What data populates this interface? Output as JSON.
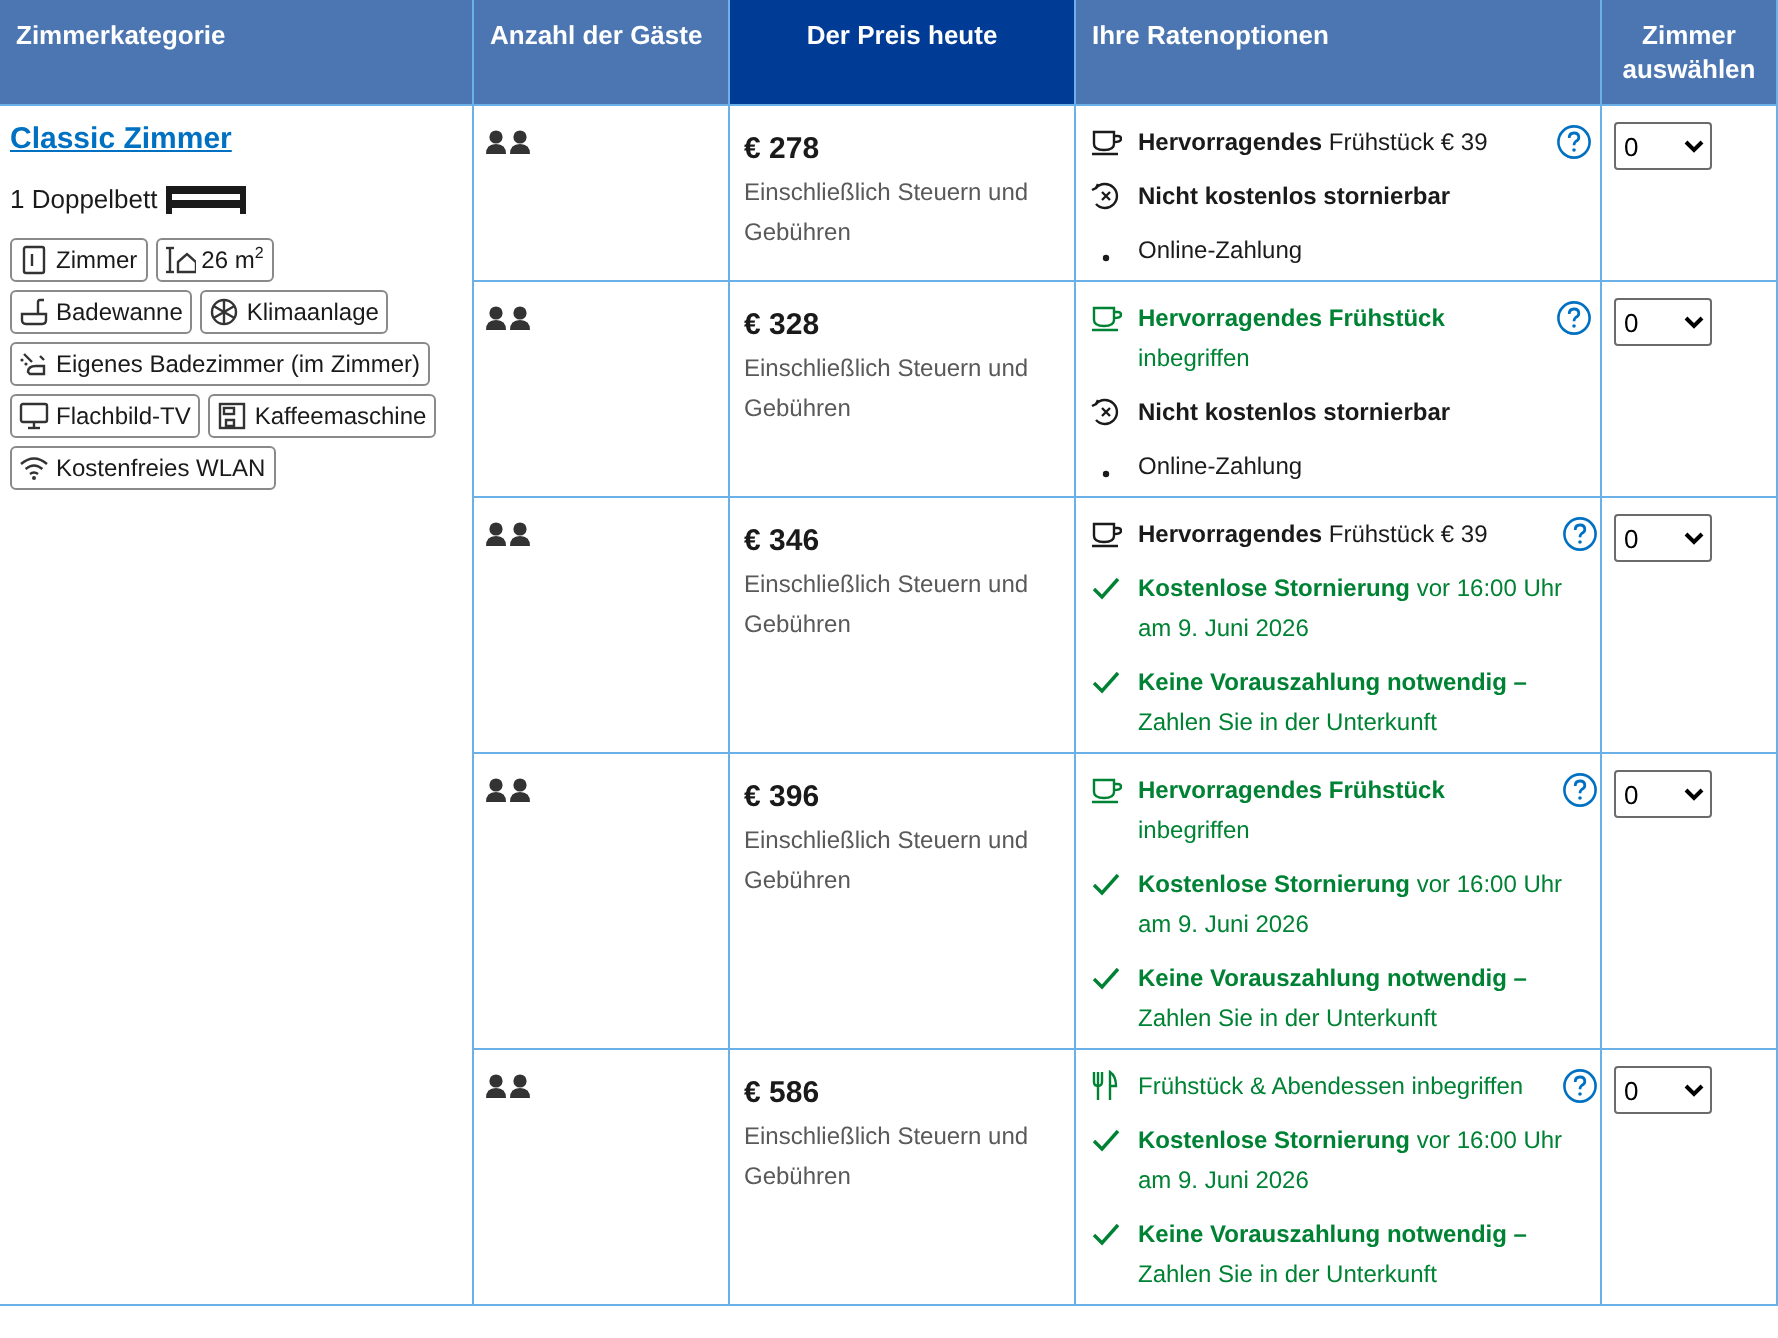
{
  "table": {
    "columns": [
      {
        "label": "Zimmerkategorie",
        "highlight": false
      },
      {
        "label": "Anzahl der Gäste",
        "highlight": false
      },
      {
        "label": "Der Preis heute",
        "highlight": true
      },
      {
        "label": "Ihre Ratenoptionen",
        "highlight": false
      },
      {
        "label": "Zimmer auswählen",
        "highlight": false
      }
    ],
    "room": {
      "name": "Classic Zimmer",
      "bed": "1 Doppelbett",
      "facilities": [
        {
          "kind": "door",
          "label": "Zimmer"
        },
        {
          "kind": "size",
          "label": "26 m$^{2}$"
        },
        {
          "kind": "bath",
          "label": "Badewanne"
        },
        {
          "kind": "snow",
          "label": "Klimaanlage"
        },
        {
          "kind": "shower",
          "label": "Eigenes Badezimmer (im Zimmer)"
        },
        {
          "kind": "tv",
          "label": "Flachbild-TV"
        },
        {
          "kind": "coffee",
          "label": "Kaffeemaschine"
        },
        {
          "kind": "wifi",
          "label": "Kostenfreies WLAN"
        }
      ]
    },
    "rows": [
      {
        "price": "€ 278",
        "price_note": "Einschließlich Steuern und Gebühren",
        "quantity": "0",
        "options": [
          {
            "kind": "cup",
            "positive": false,
            "lines": [
              "**Hervorragendes** Frühstück € 39"
            ]
          },
          {
            "kind": "cross",
            "positive": false,
            "lines": [
              "**Nicht kostenlos stornierbar**"
            ]
          },
          {
            "kind": "dot",
            "positive": false,
            "lines": [
              "Online-Zahlung"
            ]
          }
        ]
      },
      {
        "price": "€ 328",
        "price_note": "Einschließlich Steuern und Gebühren",
        "quantity": "0",
        "options": [
          {
            "kind": "cup",
            "positive": true,
            "lines": [
              "**Hervorragendes Frühstück**",
              "inbegriffen"
            ]
          },
          {
            "kind": "cross",
            "positive": false,
            "lines": [
              "**Nicht kostenlos stornierbar**"
            ]
          },
          {
            "kind": "dot",
            "positive": false,
            "lines": [
              "Online-Zahlung"
            ]
          }
        ]
      },
      {
        "price": "€ 346",
        "price_note": "Einschließlich Steuern und Gebühren",
        "quantity": "0",
        "options": [
          {
            "kind": "cup",
            "positive": false,
            "lines": [
              "**Hervorragendes** Frühstück € 39"
            ]
          },
          {
            "kind": "check",
            "positive": true,
            "lines": [
              "**Kostenlose Stornierung** vor 16:00 Uhr",
              "am 9. Juni 2026"
            ]
          },
          {
            "kind": "check",
            "positive": true,
            "lines": [
              "**Keine Vorauszahlung notwendig –**",
              "Zahlen Sie in der Unterkunft"
            ]
          }
        ]
      },
      {
        "price": "€ 396",
        "price_note": "Einschließlich Steuern und Gebühren",
        "quantity": "0",
        "options": [
          {
            "kind": "cup",
            "positive": true,
            "lines": [
              "**Hervorragendes Frühstück**",
              "inbegriffen"
            ]
          },
          {
            "kind": "check",
            "positive": true,
            "lines": [
              "**Kostenlose Stornierung** vor 16:00 Uhr",
              "am 9. Juni 2026"
            ]
          },
          {
            "kind": "check",
            "positive": true,
            "lines": [
              "**Keine Vorauszahlung notwendig –**",
              "Zahlen Sie in der Unterkunft"
            ]
          }
        ]
      },
      {
        "price": "€ 586",
        "price_note": "Einschließlich Steuern und Gebühren",
        "quantity": "0",
        "options": [
          {
            "kind": "cutlery",
            "positive": true,
            "lines": [
              "Frühstück & Abendessen inbegriffen"
            ]
          },
          {
            "kind": "check",
            "positive": true,
            "lines": [
              "**Kostenlose Stornierung** vor 16:00 Uhr",
              "am 9. Juni 2026"
            ]
          },
          {
            "kind": "check",
            "positive": true,
            "lines": [
              "**Keine Vorauszahlung notwendig –**",
              "Zahlen Sie in der Unterkunft"
            ]
          }
        ]
      }
    ]
  }
}
